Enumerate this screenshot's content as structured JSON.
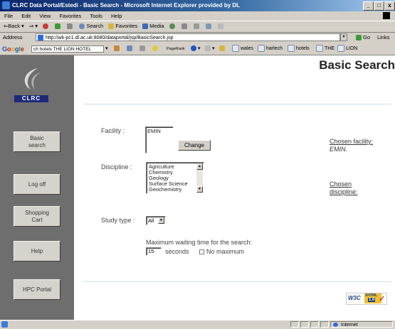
{
  "window": {
    "title": "CLRC Data Portal/Estedi - Basic Search - Microsoft Internet Explorer provided by DL",
    "min": "_",
    "max": "□",
    "close": "x"
  },
  "menu": [
    "File",
    "Edit",
    "View",
    "Favorites",
    "Tools",
    "Help"
  ],
  "toolbar": {
    "back": "⇐Back",
    "forward": "⇒",
    "search": "Search",
    "favorites": "Favorites",
    "media": "Media"
  },
  "address": {
    "label": "Address",
    "url": "http://wk-pc1.dl.ac.uk:8080/dataportal/jsp/BasicSearch.jsp",
    "go": "Go",
    "links": "Links"
  },
  "googlebar": {
    "logo": [
      "G",
      "o",
      "o",
      "g",
      "l",
      "e"
    ],
    "search_text": "ch hotels THE LION HOTEL",
    "pagerank": "PageRank",
    "buttons": [
      "wales",
      "harlech",
      "hotels",
      "THE",
      "LION"
    ]
  },
  "sidebar": {
    "logo_text": "CLRC",
    "items": [
      {
        "label": "Basic search"
      },
      {
        "label": "Log off"
      },
      {
        "label": "Shopping Cart"
      },
      {
        "label": "Help"
      },
      {
        "label": "HPC Portal"
      }
    ]
  },
  "main": {
    "title": "Basic Search",
    "facility_label": "Facility :",
    "facility_value": "EMIN",
    "change_button": "Change",
    "chosen_facility_label": "Chosen facility:",
    "chosen_facility_value": "EMIN.",
    "discipline_label": "Discipline :",
    "disciplines": [
      "Agriculture",
      "Chemistry",
      "Geology",
      "Surface Science",
      "Geochemistry"
    ],
    "chosen_discipline_label": "Chosen discipline:",
    "study_type_label": "Study type :",
    "study_type_value": "All",
    "max_wait_label": "Maximum waiting time for the search:",
    "wait_value": "15",
    "seconds_label": "seconds",
    "no_maximum_label": "No maximum",
    "w3c_text": "W3C",
    "xhtml_text": "XHTML",
    "xhtml_version": "1.0"
  },
  "status": {
    "zone": "Internet"
  }
}
